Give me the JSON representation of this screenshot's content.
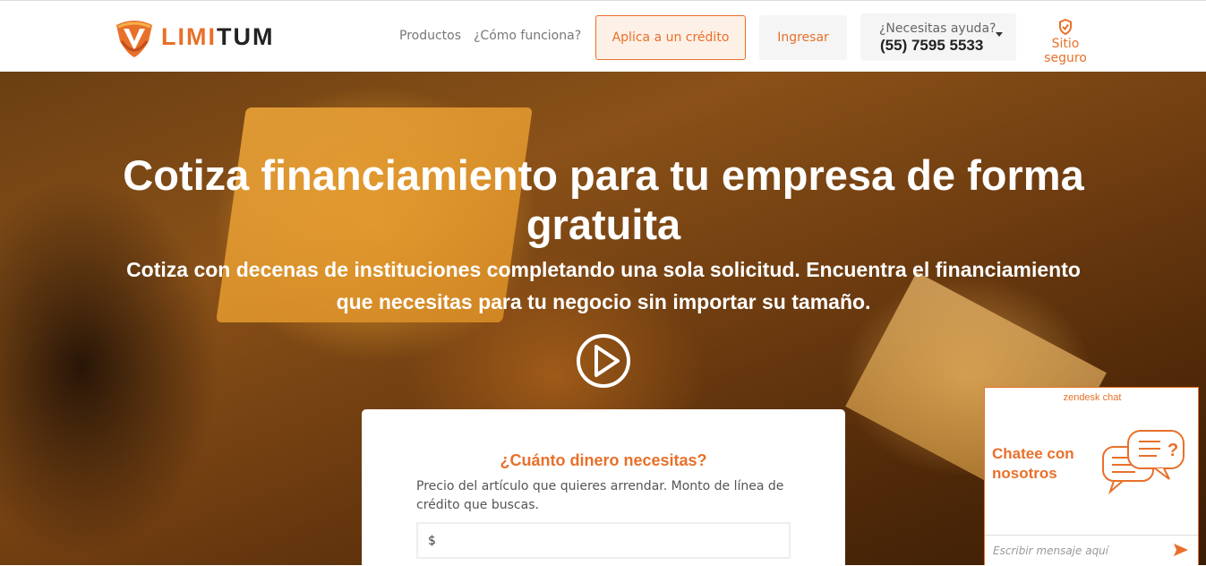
{
  "brand": {
    "logo_part1": "LIMI",
    "logo_part2": "TUM",
    "accent": "#e8702a"
  },
  "nav": {
    "products": "Productos",
    "how_it_works": "¿Cómo funciona?",
    "apply": "Aplica a un crédito",
    "login": "Ingresar",
    "help_question": "¿Necesitas ayuda?",
    "help_phone": "(55) 7595 5533",
    "secure": "Sitio seguro"
  },
  "hero": {
    "title": "Cotiza financiamiento para tu empresa de forma gratuita",
    "subtitle": "Cotiza con decenas de instituciones completando una sola solicitud. Encuentra el financiamiento que necesitas para tu negocio sin importar su tamaño."
  },
  "form": {
    "title": "¿Cuánto dinero necesitas?",
    "description": "Precio del artículo que quieres arrendar. Monto de línea de crédito que buscas.",
    "amount_prefix": "$"
  },
  "chat": {
    "brand": "zendesk chat",
    "headline": "Chatee con nosotros",
    "input_placeholder": "Escribir mensaje aquí"
  }
}
